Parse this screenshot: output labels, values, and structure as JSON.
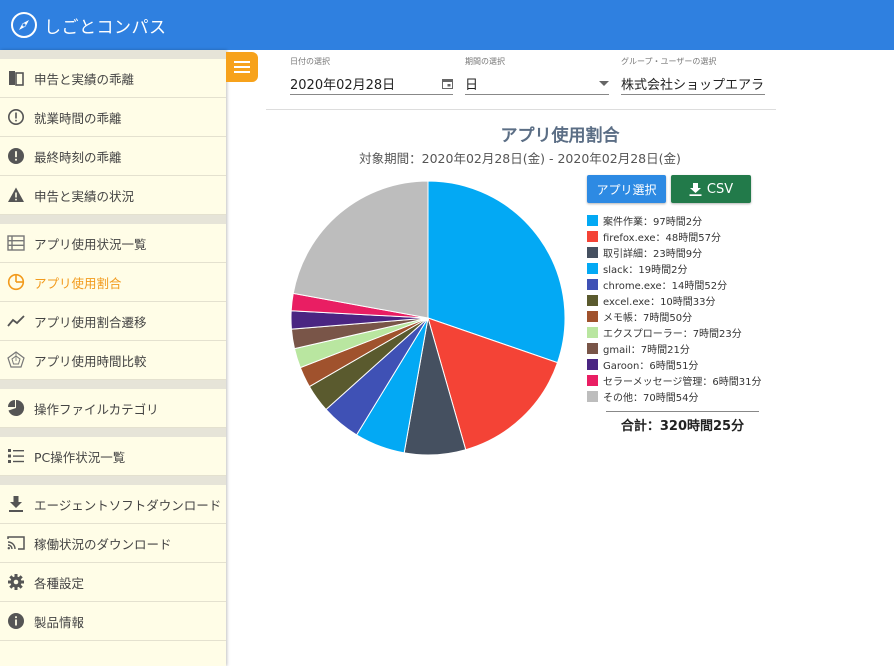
{
  "app": {
    "title": "しごとコンパス"
  },
  "sidebar": {
    "groups": [
      [
        {
          "label": "申告と実績の乖離",
          "icon": "doc-compare-icon"
        },
        {
          "label": "就業時間の乖離",
          "icon": "alert-circle-outline-icon"
        },
        {
          "label": "最終時刻の乖離",
          "icon": "alert-circle-icon"
        },
        {
          "label": "申告と実績の状況",
          "icon": "warning-icon"
        }
      ],
      [
        {
          "label": "アプリ使用状況一覧",
          "icon": "list-panel-icon"
        },
        {
          "label": "アプリ使用割合",
          "icon": "pie-outline-icon",
          "active": true
        },
        {
          "label": "アプリ使用割合遷移",
          "icon": "trend-icon"
        },
        {
          "label": "アプリ使用時間比較",
          "icon": "radar-icon"
        }
      ],
      [
        {
          "label": "操作ファイルカテゴリ",
          "icon": "pie-icon"
        }
      ],
      [
        {
          "label": "PC操作状況一覧",
          "icon": "list-icon"
        }
      ],
      [
        {
          "label": "エージェントソフトダウンロード",
          "icon": "download-icon"
        },
        {
          "label": "稼働状況のダウンロード",
          "icon": "cast-icon"
        },
        {
          "label": "各種設定",
          "icon": "gear-icon"
        },
        {
          "label": "製品情報",
          "icon": "info-icon"
        }
      ]
    ]
  },
  "filters": {
    "date": {
      "label": "日付の選択",
      "value": "2020年02月28日"
    },
    "period": {
      "label": "期間の選択",
      "value": "日"
    },
    "group": {
      "label": "グループ・ユーザーの選択",
      "value": "株式会社ショップエアラ"
    }
  },
  "buttons": {
    "app_select": "アプリ選択",
    "csv": "CSV"
  },
  "chart_data": {
    "type": "pie",
    "title": "アプリ使用割合",
    "subtitle": "対象期間：2020年02月28日(金) - 2020年02月28日(金)",
    "unit": "minutes",
    "start_angle": "12 o'clock, clockwise",
    "legend_position": "right",
    "slices": [
      {
        "name": "案件作業",
        "label": "案件作業：97時間2分",
        "value": 5822,
        "color": "#03a9f4"
      },
      {
        "name": "firefox.exe",
        "label": "firefox.exe：48時間57分",
        "value": 2937,
        "color": "#f44336"
      },
      {
        "name": "取引詳細",
        "label": "取引詳細：23時間9分",
        "value": 1389,
        "color": "#455060"
      },
      {
        "name": "slack",
        "label": "slack：19時間2分",
        "value": 1142,
        "color": "#03a9f4"
      },
      {
        "name": "chrome.exe",
        "label": "chrome.exe：14時間52分",
        "value": 892,
        "color": "#3f51b5"
      },
      {
        "name": "excel.exe",
        "label": "excel.exe：10時間33分",
        "value": 633,
        "color": "#5a5a2e"
      },
      {
        "name": "メモ帳",
        "label": "メモ帳：7時間50分",
        "value": 470,
        "color": "#a0522d"
      },
      {
        "name": "エクスプローラー",
        "label": "エクスプローラー：7時間23分",
        "value": 443,
        "color": "#b9e6a0"
      },
      {
        "name": "gmail",
        "label": "gmail：7時間21分",
        "value": 441,
        "color": "#795548"
      },
      {
        "name": "Garoon",
        "label": "Garoon：6時間51分",
        "value": 411,
        "color": "#4a2582"
      },
      {
        "name": "セラーメッセージ管理",
        "label": "セラーメッセージ管理：6時間31分",
        "value": 391,
        "color": "#e91e63"
      },
      {
        "name": "その他",
        "label": "その他：70時間54分",
        "value": 4254,
        "color": "#bdbdbd"
      }
    ],
    "total_label": "合計：320時間25分"
  }
}
